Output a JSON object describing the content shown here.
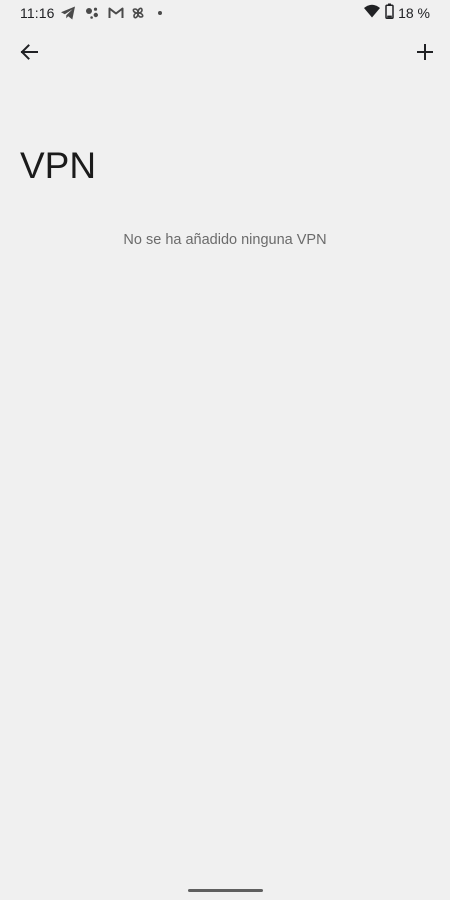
{
  "status_bar": {
    "time": "11:16",
    "battery": "18 %",
    "notification_icons": [
      "telegram-icon",
      "assistant-icon",
      "gmail-icon",
      "pinwheel-icon",
      "more-dot-icon"
    ],
    "system_icons": [
      "wifi-icon",
      "battery-icon"
    ]
  },
  "toolbar": {
    "back_icon": "arrow-back-icon",
    "add_icon": "plus-icon"
  },
  "page": {
    "title": "VPN",
    "empty_message": "No se ha añadido ninguna VPN"
  },
  "colors": {
    "background": "#f0f0f0",
    "title_text": "#1b1b1b",
    "secondary_text": "#6b6b6b"
  }
}
